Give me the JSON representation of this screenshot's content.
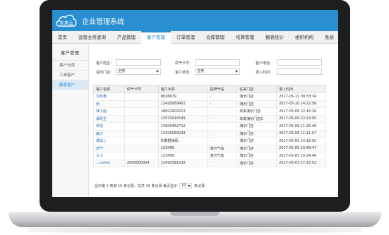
{
  "header": {
    "logo_text": "未来云",
    "title": "企业管理系统",
    "brand_color": "#2a8fd1"
  },
  "nav": [
    {
      "label": "首页"
    },
    {
      "label": "运营业务查询"
    },
    {
      "label": "产品管理"
    },
    {
      "label": "客户管理"
    },
    {
      "label": "订单管理"
    },
    {
      "label": "仓库管理"
    },
    {
      "label": "结算管理"
    },
    {
      "label": "报表统计"
    },
    {
      "label": "组织机构"
    },
    {
      "label": "系统"
    }
  ],
  "sidebar": {
    "title": "客户管理",
    "items": [
      {
        "label": "客户分类"
      },
      {
        "label": "工商客户"
      },
      {
        "label": "散客客户"
      }
    ]
  },
  "filters": {
    "name_label": "客户姓名：",
    "card_label": "供气卡号：",
    "phone_label": "客户电话：",
    "store_label": "往所门店：",
    "store_value": "全部",
    "status_label": "客户状态：",
    "status_value": "在用",
    "time_label": "录入时间："
  },
  "table": {
    "headers": [
      "客户名称",
      "供气卡号",
      "客户手机",
      "提带气站",
      "往来门店",
      "录入时间"
    ],
    "rows": [
      [
        "刘鸣艳",
        "",
        "8826679",
        "-",
        "演示门店",
        "2017-05-11 09:33:34"
      ],
      [
        "张",
        "",
        "13420958452",
        "-",
        "演示门店",
        "2017-05-10 14:22:58"
      ],
      [
        "林小姐",
        "",
        "18822902013",
        "-",
        "未来演示门店",
        "2017-05-09 22:16:20"
      ],
      [
        "谭先生",
        "",
        "13570916549",
        "-",
        "未来演示门店1",
        "2017-05-09 22:14:05"
      ],
      [
        "伟浩",
        "",
        "13500452715",
        "-",
        "演示门店",
        "2017-05-08 11:25:46"
      ],
      [
        "威少",
        "",
        "13425089234",
        "-",
        "演示门店",
        "2017-05-08 11:11:07"
      ],
      [
        "基础上",
        "",
        "的数据读佰",
        "-",
        "演示门店",
        "2017-05-05 14:16:50"
      ],
      [
        "茂气",
        "",
        "123456",
        "演示气站",
        "演示门店",
        "2017-05-05 10:48:47"
      ],
      [
        "大小",
        "",
        "123456",
        "演示气站",
        "演示门店",
        "2017-05-05 10:24:46"
      ],
      [
        "...turkey",
        "2000000054",
        "13420381528",
        "-",
        "演示门店",
        "2017-05-03 17:15:52"
      ]
    ]
  },
  "pager": {
    "text_before": "显示第 1 到第 10 条记录，总共 42 条记录 每页显示",
    "page_size": "10",
    "text_after": "条记录"
  }
}
